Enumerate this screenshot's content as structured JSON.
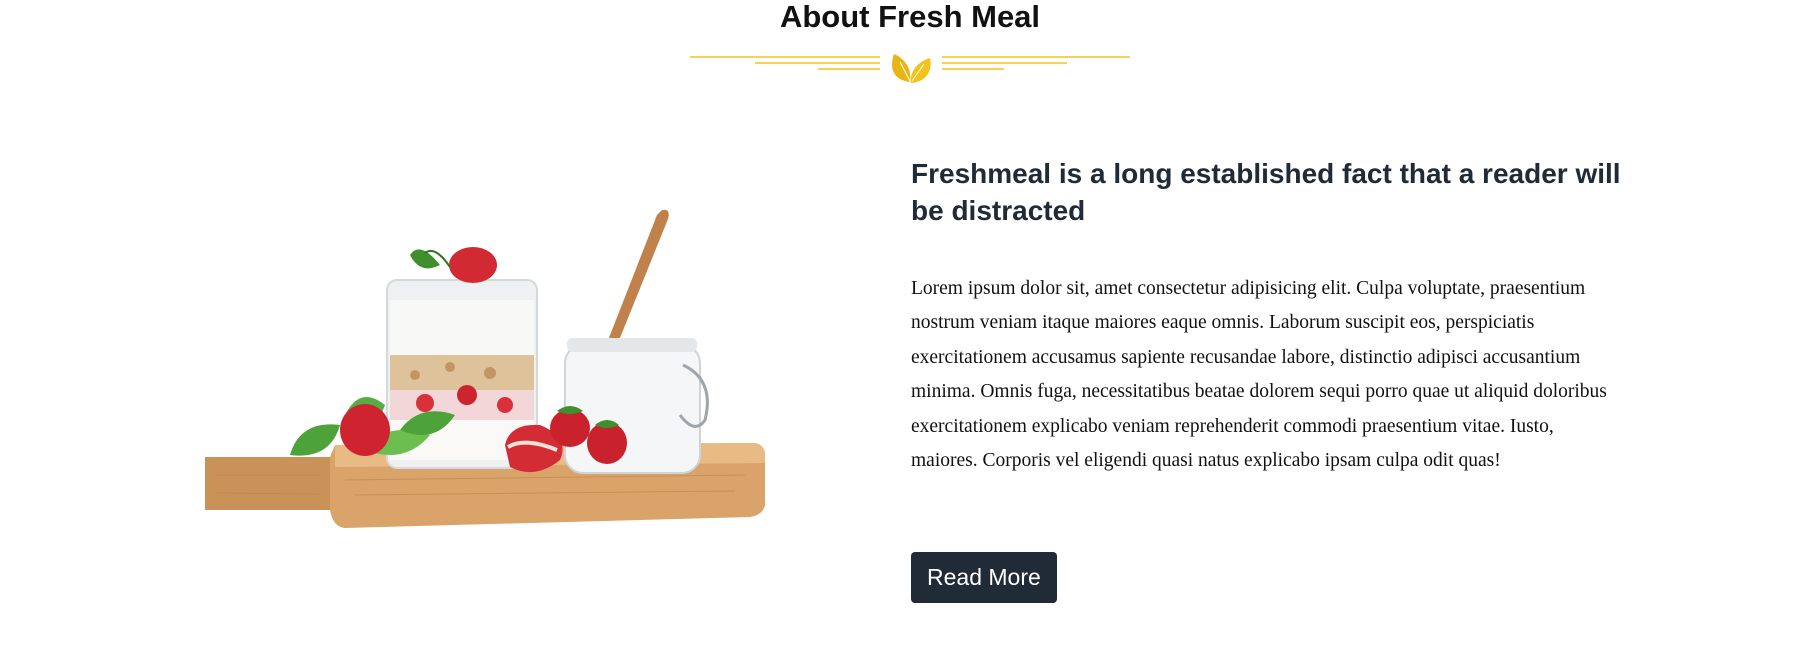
{
  "about": {
    "title": "About Fresh Meal",
    "divider_icon": "leaf-icon",
    "accent_color": "#f2c31a"
  },
  "content": {
    "headline": "Freshmeal is a long established fact that a reader will be distracted",
    "paragraph": "Lorem ipsum dolor sit, amet consectetur adipisicing elit. Culpa voluptate, praesentium nostrum veniam itaque maiores eaque omnis. Laborum suscipit eos, perspiciatis exercitationem accusamus sapiente recusandae labore, distinctio adipisci accusantium minima. Omnis fuga, necessitatibus beatae dolorem sequi porro quae ut aliquid doloribus exercitationem explicabo veniam reprehenderit commodi praesentium vitae. Iusto, maiores. Corporis vel eligendi quasi natus explicabo ipsam culpa odit quas!",
    "button_label": "Read More",
    "button_color": "#212a37"
  },
  "image": {
    "subject": "yogurt-parfait-with-strawberries-on-wooden-board"
  }
}
